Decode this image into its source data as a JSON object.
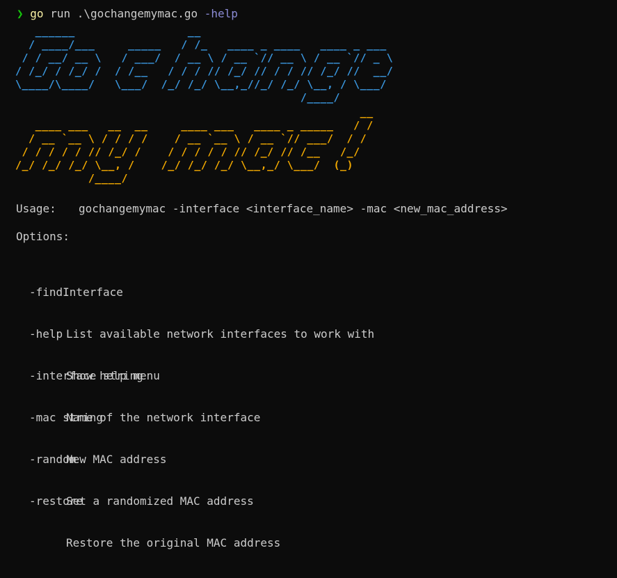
{
  "command": {
    "prompt_symbol": "❯",
    "program": "go",
    "args": "run .\\gochangemymac.go",
    "flag": "-help"
  },
  "banner": {
    "line1_text": "Go change",
    "line1_color": "#3a96dd",
    "line2_text": "my mac!",
    "line2_color": "#f2a900"
  },
  "usage": {
    "label": "Usage:",
    "value": "gochangemymac -interface <interface_name> -mac <new_mac_address>"
  },
  "options_heading": "Options:",
  "options": [
    {
      "flag": "-findInterface",
      "description": "List available network interfaces to work with"
    },
    {
      "flag": "-help",
      "description": "Show help menu"
    },
    {
      "flag": "-interface string",
      "description": "Name of the network interface"
    },
    {
      "flag": "-mac string",
      "description": "New MAC address"
    },
    {
      "flag": "-random",
      "description": "Set a randomized MAC address"
    },
    {
      "flag": "-restore",
      "description": "Restore the original MAC address"
    }
  ]
}
